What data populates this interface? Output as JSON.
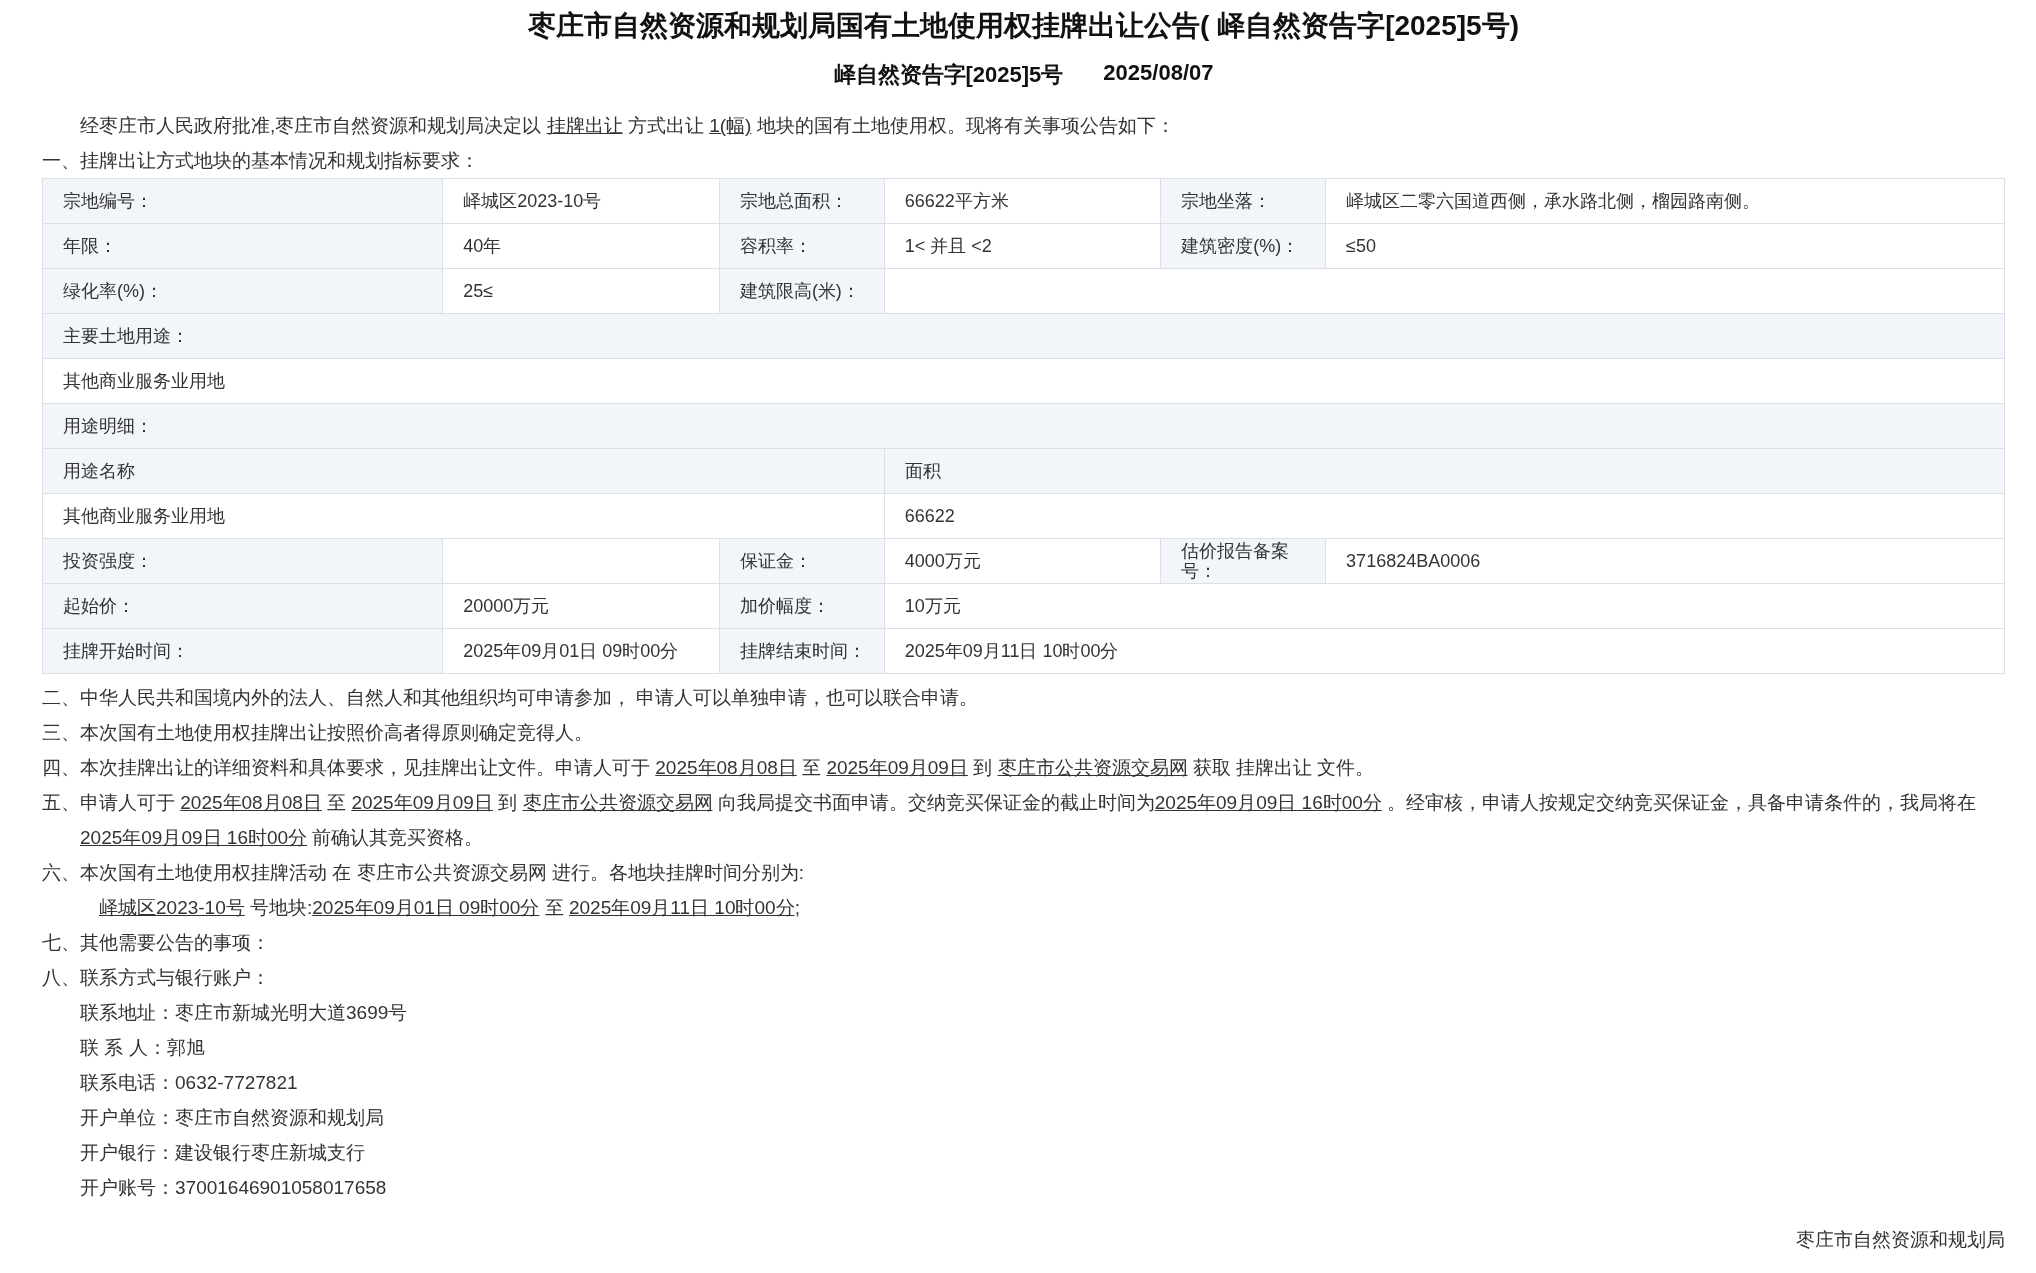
{
  "title": "枣庄市自然资源和规划局国有土地使用权挂牌出让公告( 峄自然资告字[2025]5号)",
  "subtitle": {
    "doc_no": "峄自然资告字[2025]5号",
    "date": "2025/08/07"
  },
  "intro": [
    {
      "kind": "text",
      "text": "经枣庄市人民政府批准,枣庄市自然资源和规划局决定以 "
    },
    {
      "kind": "link",
      "text": "挂牌出让"
    },
    {
      "kind": "text",
      "text": " 方式出让 "
    },
    {
      "kind": "link",
      "text": "1(幅)"
    },
    {
      "kind": "text",
      "text": " 地块的国有土地使用权。现将有关事项公告如下："
    }
  ],
  "section_1": "一、挂牌出让方式地块的基本情况和规划指标要求：",
  "table": {
    "rows": [
      {
        "cells": [
          {
            "kind": "label",
            "text": "宗地编号："
          },
          {
            "kind": "value",
            "text": "峄城区2023-10号"
          },
          {
            "kind": "label",
            "text": "宗地总面积："
          },
          {
            "kind": "value",
            "text": "66622平方米"
          },
          {
            "kind": "label",
            "text": "宗地坐落："
          },
          {
            "kind": "value",
            "text": "峄城区二零六国道西侧，承水路北侧，榴园路南侧。"
          }
        ]
      },
      {
        "cells": [
          {
            "kind": "label",
            "text": "年限："
          },
          {
            "kind": "value",
            "text": "40年"
          },
          {
            "kind": "label",
            "text": "容积率："
          },
          {
            "kind": "value",
            "text": "1< 并且 <2"
          },
          {
            "kind": "label",
            "text": "建筑密度(%)："
          },
          {
            "kind": "value",
            "text": "≤50"
          }
        ]
      },
      {
        "cells": [
          {
            "kind": "label",
            "text": "绿化率(%)："
          },
          {
            "kind": "value",
            "text": "25≤"
          },
          {
            "kind": "label",
            "text": "建筑限高(米)："
          },
          {
            "kind": "value",
            "colspan": 3
          }
        ]
      },
      {
        "cells": [
          {
            "kind": "label",
            "text": "主要土地用途：",
            "colspan": 6
          }
        ]
      },
      {
        "cells": [
          {
            "kind": "value",
            "text": "其他商业服务业用地",
            "colspan": 6
          }
        ]
      },
      {
        "cells": [
          {
            "kind": "label",
            "text": "用途明细：",
            "colspan": 6
          }
        ]
      },
      {
        "cells": [
          {
            "kind": "label",
            "text": "用途名称",
            "colspan": 3
          },
          {
            "kind": "label",
            "text": "面积",
            "colspan": 3
          }
        ]
      },
      {
        "cells": [
          {
            "kind": "value",
            "text": "其他商业服务业用地",
            "colspan": 3
          },
          {
            "kind": "value",
            "text": "66622",
            "colspan": 3
          }
        ]
      },
      {
        "cells": [
          {
            "kind": "label",
            "text": "投资强度："
          },
          {
            "kind": "value"
          },
          {
            "kind": "label",
            "text": "保证金："
          },
          {
            "kind": "value",
            "text": "4000万元"
          },
          {
            "kind": "label",
            "text": "估价报告备案号："
          },
          {
            "kind": "value",
            "text": "3716824BA0006"
          }
        ]
      },
      {
        "cells": [
          {
            "kind": "label",
            "text": "起始价："
          },
          {
            "kind": "value",
            "text": "20000万元"
          },
          {
            "kind": "label",
            "text": "加价幅度："
          },
          {
            "kind": "value",
            "text": "10万元",
            "colspan": 3
          }
        ]
      },
      {
        "cells": [
          {
            "kind": "label",
            "text": "挂牌开始时间："
          },
          {
            "kind": "value",
            "text": "2025年09月01日 09时00分"
          },
          {
            "kind": "label",
            "text": "挂牌结束时间："
          },
          {
            "kind": "value",
            "text": "2025年09月11日 10时00分",
            "colspan": 3
          }
        ]
      }
    ]
  },
  "paragraphs": [
    {
      "kind": "item",
      "segments": [
        {
          "kind": "text",
          "text": "二、中华人民共和国境内外的法人、自然人和其他组织均可申请参加， 申请人可以单独申请，也可以联合申请。"
        }
      ]
    },
    {
      "kind": "item",
      "segments": [
        {
          "kind": "text",
          "text": "三、本次国有土地使用权挂牌出让按照价高者得原则确定竞得人。"
        }
      ]
    },
    {
      "kind": "item",
      "segments": [
        {
          "kind": "text",
          "text": "四、本次挂牌出让的详细资料和具体要求，见挂牌出让文件。申请人可于 "
        },
        {
          "kind": "link",
          "text": "2025年08月08日"
        },
        {
          "kind": "text",
          "text": " 至 "
        },
        {
          "kind": "link",
          "text": "2025年09月09日"
        },
        {
          "kind": "text",
          "text": " 到 "
        },
        {
          "kind": "link",
          "text": "枣庄市公共资源交易网"
        },
        {
          "kind": "text",
          "text": " 获取 挂牌出让 文件。"
        }
      ]
    },
    {
      "kind": "item",
      "segments": [
        {
          "kind": "text",
          "text": "五、申请人可于 "
        },
        {
          "kind": "link",
          "text": "2025年08月08日"
        },
        {
          "kind": "text",
          "text": " 至 "
        },
        {
          "kind": "link",
          "text": "2025年09月09日"
        },
        {
          "kind": "text",
          "text": " 到 "
        },
        {
          "kind": "link",
          "text": "枣庄市公共资源交易网"
        },
        {
          "kind": "text",
          "text": " 向我局提交书面申请。交纳竞买保证金的截止时间为"
        },
        {
          "kind": "link",
          "text": "2025年09月09日 16时00分"
        },
        {
          "kind": "text",
          "text": " 。经审核，申请人按规定交纳竞买保证金，具备申请条件的，我局将在 "
        },
        {
          "kind": "link",
          "text": "2025年09月09日 16时00分"
        },
        {
          "kind": "text",
          "text": " 前确认其竞买资格。"
        }
      ]
    },
    {
      "kind": "item",
      "segments": [
        {
          "kind": "text",
          "text": "六、本次国有土地使用权挂牌活动 在 枣庄市公共资源交易网 进行。各地块挂牌时间分别为:"
        }
      ]
    },
    {
      "kind": "sub",
      "segments": [
        {
          "kind": "link",
          "text": "峄城区2023-10号"
        },
        {
          "kind": "text",
          "text": " 号地块:"
        },
        {
          "kind": "link",
          "text": "2025年09月01日 09时00分"
        },
        {
          "kind": "text",
          "text": " 至 "
        },
        {
          "kind": "link",
          "text": "2025年09月11日 10时00分"
        },
        {
          "kind": "text",
          "text": ";"
        }
      ]
    },
    {
      "kind": "item",
      "segments": [
        {
          "kind": "text",
          "text": "七、其他需要公告的事项："
        }
      ]
    },
    {
      "kind": "item",
      "segments": [
        {
          "kind": "text",
          "text": "八、联系方式与银行账户："
        }
      ]
    },
    {
      "kind": "contact",
      "segments": [
        {
          "kind": "text",
          "text": "联系地址：枣庄市新城光明大道3699号"
        }
      ]
    },
    {
      "kind": "contact",
      "segments": [
        {
          "kind": "text",
          "text": "联 系 人：郭旭"
        }
      ]
    },
    {
      "kind": "contact",
      "segments": [
        {
          "kind": "text",
          "text": "联系电话：0632-7727821"
        }
      ]
    },
    {
      "kind": "contact",
      "segments": [
        {
          "kind": "text",
          "text": "开户单位：枣庄市自然资源和规划局"
        }
      ]
    },
    {
      "kind": "contact",
      "segments": [
        {
          "kind": "text",
          "text": "开户银行：建设银行枣庄新城支行"
        }
      ]
    },
    {
      "kind": "contact",
      "segments": [
        {
          "kind": "text",
          "text": "开户账号：37001646901058017658"
        }
      ]
    }
  ],
  "signature": "枣庄市自然资源和规划局"
}
